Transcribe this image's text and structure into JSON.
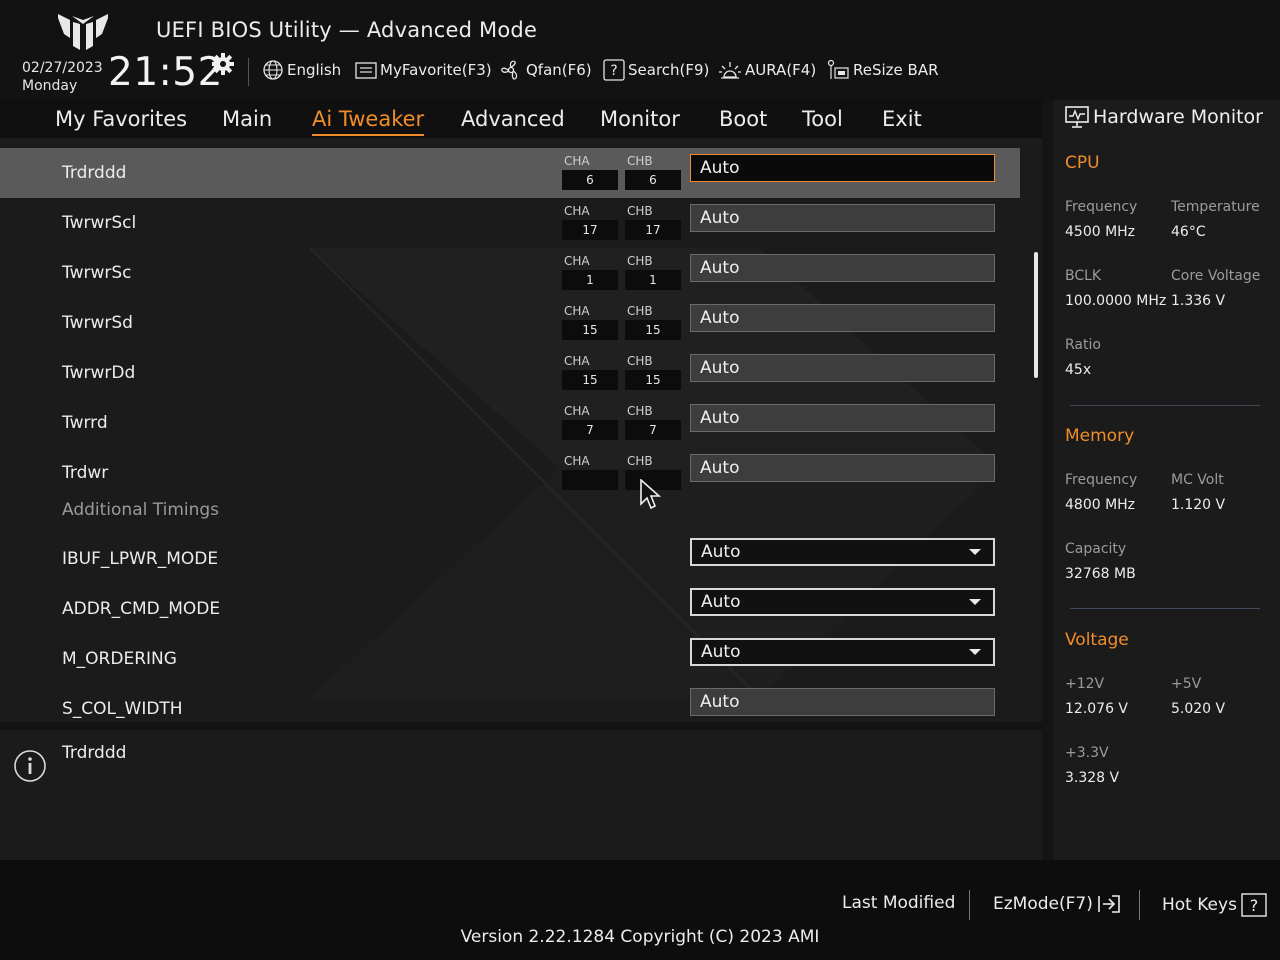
{
  "header": {
    "title": "UEFI BIOS Utility — Advanced Mode",
    "date": "02/27/2023",
    "day": "Monday",
    "time": "21:52",
    "tools": [
      {
        "label": "English",
        "icon": "globe-icon"
      },
      {
        "label": "MyFavorite(F3)",
        "icon": "favorite-list-icon"
      },
      {
        "label": "Qfan(F6)",
        "icon": "fan-icon"
      },
      {
        "label": "Search(F9)",
        "icon": "search-help-icon"
      },
      {
        "label": "AURA(F4)",
        "icon": "aura-light-icon"
      },
      {
        "label": "ReSize BAR",
        "icon": "resize-bar-icon"
      }
    ]
  },
  "nav": {
    "tabs": [
      "My Favorites",
      "Main",
      "Ai Tweaker",
      "Advanced",
      "Monitor",
      "Boot",
      "Tool",
      "Exit"
    ],
    "active": "Ai Tweaker"
  },
  "settings": {
    "rows": [
      {
        "label": "Trdrddd",
        "cha_label": "CHA",
        "chb_label": "CHB",
        "cha": "6",
        "chb": "6",
        "value": "Auto",
        "selected": true
      },
      {
        "label": "TwrwrScl",
        "cha_label": "CHA",
        "chb_label": "CHB",
        "cha": "17",
        "chb": "17",
        "value": "Auto"
      },
      {
        "label": "TwrwrSc",
        "cha_label": "CHA",
        "chb_label": "CHB",
        "cha": "1",
        "chb": "1",
        "value": "Auto"
      },
      {
        "label": "TwrwrSd",
        "cha_label": "CHA",
        "chb_label": "CHB",
        "cha": "15",
        "chb": "15",
        "value": "Auto"
      },
      {
        "label": "TwrwrDd",
        "cha_label": "CHA",
        "chb_label": "CHB",
        "cha": "15",
        "chb": "15",
        "value": "Auto"
      },
      {
        "label": "Twrrd",
        "cha_label": "CHA",
        "chb_label": "CHB",
        "cha": "7",
        "chb": "7",
        "value": "Auto"
      },
      {
        "label": "Trdwr",
        "cha_label": "CHA",
        "chb_label": "CHB",
        "cha": "",
        "chb": "",
        "value": "Auto"
      },
      {
        "label": "Additional Timings"
      },
      {
        "label": "IBUF_LPWR_MODE",
        "value": "Auto"
      },
      {
        "label": "ADDR_CMD_MODE",
        "value": "Auto"
      },
      {
        "label": "M_ORDERING",
        "value": "Auto"
      },
      {
        "label": "S_COL_WIDTH",
        "value": "Auto"
      }
    ]
  },
  "help": {
    "text": "Trdrddd",
    "icon": "info-icon"
  },
  "hardware_monitor": {
    "title": "Hardware Monitor",
    "cpu": {
      "title": "CPU",
      "frequency_label": "Frequency",
      "frequency": "4500 MHz",
      "temperature_label": "Temperature",
      "temperature": "46°C",
      "bclk_label": "BCLK",
      "bclk": "100.0000 MHz",
      "core_voltage_label": "Core Voltage",
      "core_voltage": "1.336 V",
      "ratio_label": "Ratio",
      "ratio": "45x"
    },
    "memory": {
      "title": "Memory",
      "frequency_label": "Frequency",
      "frequency": "4800 MHz",
      "mc_volt_label": "MC Volt",
      "mc_volt": "1.120 V",
      "capacity_label": "Capacity",
      "capacity": "32768 MB"
    },
    "voltage": {
      "title": "Voltage",
      "v12_label": "+12V",
      "v12": "12.076 V",
      "v5_label": "+5V",
      "v5": "5.020 V",
      "v33_label": "+3.3V",
      "v33": "3.328 V"
    }
  },
  "footer": {
    "last_modified": "Last Modified",
    "ezmode": "EzMode(F7)",
    "hotkeys": "Hot Keys",
    "version": "Version 2.22.1284 Copyright (C) 2023 AMI"
  },
  "colors": {
    "accent": "#f08d2a",
    "background": "#141414",
    "panel": "#1b1b1b"
  }
}
